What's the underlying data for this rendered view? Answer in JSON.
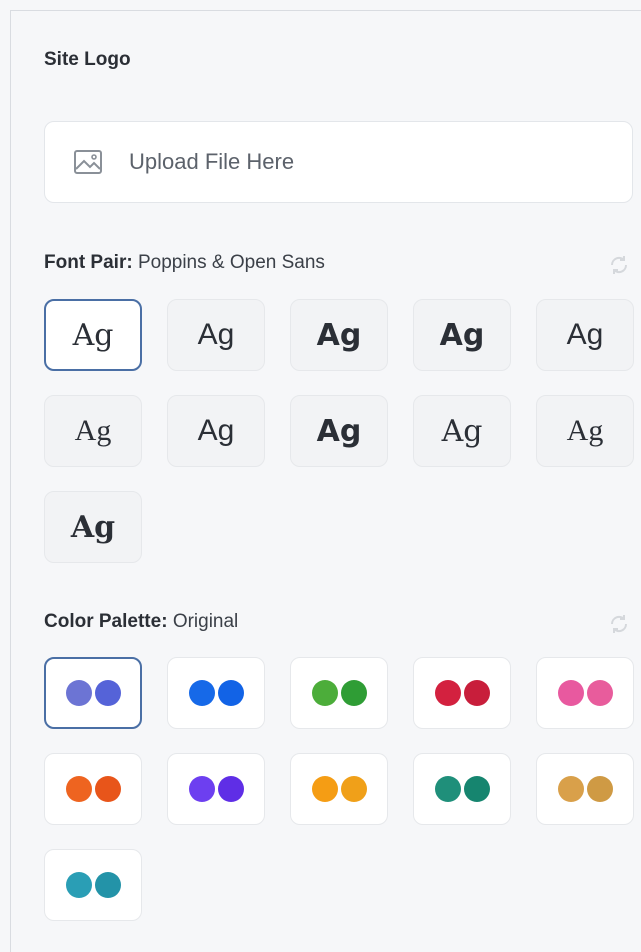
{
  "site_logo": {
    "title": "Site Logo",
    "upload_label": "Upload File Here",
    "icon": "image-icon"
  },
  "font_pair": {
    "label": "Font Pair:",
    "value": "Poppins & Open Sans",
    "samples": [
      "Ag",
      "Ag",
      "Ag",
      "Ag",
      "Ag",
      "Ag",
      "Ag",
      "Ag",
      "Ag",
      "Ag",
      "Ag"
    ]
  },
  "color_palette": {
    "label": "Color Palette:",
    "value": "Original",
    "palettes": [
      [
        "#6c74d4",
        "#5563d8"
      ],
      [
        "#1669e8",
        "#1263e6"
      ],
      [
        "#4cad3a",
        "#2f9d35"
      ],
      [
        "#d3213f",
        "#c81e3b"
      ],
      [
        "#e8599f",
        "#e85c9c"
      ],
      [
        "#ee6420",
        "#e8551a"
      ],
      [
        "#6d3ff0",
        "#5f2ee6"
      ],
      [
        "#f59d14",
        "#f0a019"
      ],
      [
        "#1f8f7a",
        "#16856f"
      ],
      [
        "#d9a04a",
        "#cf9a44"
      ],
      [
        "#2a9eb5",
        "#2393a8"
      ]
    ]
  },
  "colors": {
    "accent": "#4a6fa5"
  }
}
